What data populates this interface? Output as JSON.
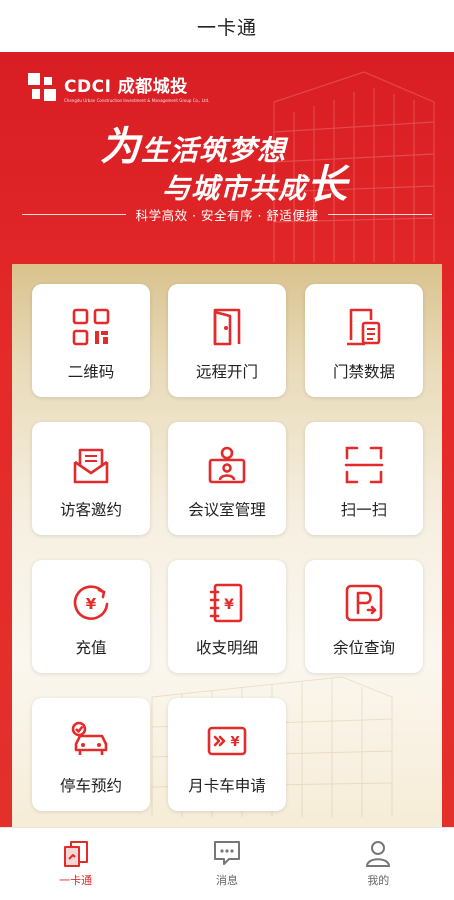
{
  "header": {
    "title": "一卡通"
  },
  "banner": {
    "brand_name": "CDCI 成都城投",
    "brand_sub": "Chengdu Urban Construction Investment & Management Group Co., Ltd.",
    "slogan_line1_big": "为",
    "slogan_line1_rest": "生活筑梦想",
    "slogan_line2_rest": "与城市共成",
    "slogan_line2_big": "长",
    "tagline": "科学高效 · 安全有序 · 舒适便捷"
  },
  "tiles": [
    {
      "label": "二维码",
      "icon": "qr-code-icon"
    },
    {
      "label": "远程开门",
      "icon": "door-icon"
    },
    {
      "label": "门禁数据",
      "icon": "access-data-icon"
    },
    {
      "label": "访客邀约",
      "icon": "mail-icon"
    },
    {
      "label": "会议室管理",
      "icon": "meeting-room-icon"
    },
    {
      "label": "扫一扫",
      "icon": "scan-icon"
    },
    {
      "label": "充值",
      "icon": "recharge-icon"
    },
    {
      "label": "收支明细",
      "icon": "ledger-icon"
    },
    {
      "label": "余位查询",
      "icon": "parking-icon"
    },
    {
      "label": "停车预约",
      "icon": "car-booking-icon"
    },
    {
      "label": "月卡车申请",
      "icon": "monthly-card-icon"
    }
  ],
  "tabs": [
    {
      "label": "一卡通",
      "icon": "card-icon",
      "active": true
    },
    {
      "label": "消息",
      "icon": "message-icon",
      "active": false
    },
    {
      "label": "我的",
      "icon": "user-icon",
      "active": false
    }
  ],
  "colors": {
    "primary": "#E32B2B",
    "gold": "#D9C28D"
  }
}
